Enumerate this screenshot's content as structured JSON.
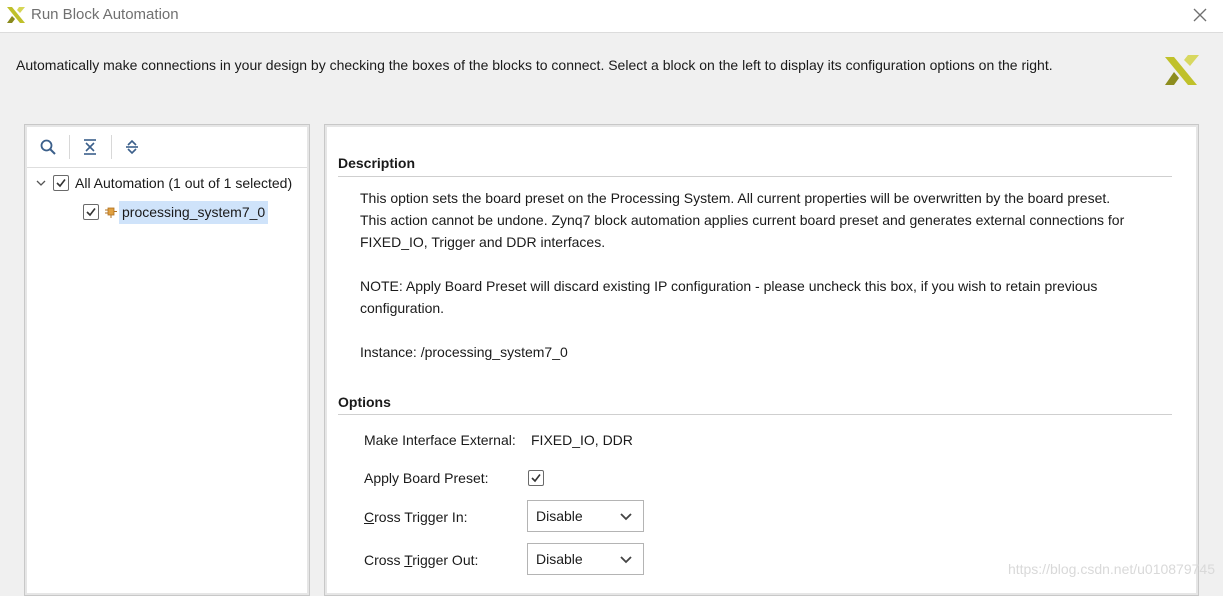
{
  "window": {
    "title": "Run Block Automation"
  },
  "header": {
    "description": "Automatically make connections in your design by checking the boxes of the blocks to connect. Select a block on the left to display its configuration options on the right."
  },
  "tree": {
    "root": {
      "label": "All Automation (1 out of 1 selected)",
      "checked": true,
      "expanded": true
    },
    "children": [
      {
        "label": "processing_system7_0",
        "checked": true,
        "selected": true
      }
    ]
  },
  "description": {
    "heading": "Description",
    "line1": "This option sets the board preset on the Processing System. All current properties will be overwritten by the board preset.",
    "line2": "This action cannot be undone. Zynq7 block automation applies current board preset and generates external connections for",
    "line3": "FIXED_IO, Trigger and DDR interfaces.",
    "note1": "NOTE: Apply Board Preset will discard existing IP configuration - please uncheck this box, if you wish to retain previous",
    "note2": "configuration.",
    "instance": "Instance: /processing_system7_0"
  },
  "options": {
    "heading": "Options",
    "make_interface_label": "Make Interface External:",
    "make_interface_value": "FIXED_IO, DDR",
    "apply_board_preset_label": "Apply Board Preset:",
    "apply_board_preset_checked": true,
    "cross_trigger_in": {
      "label_first": "C",
      "label_rest": "ross Trigger In:",
      "value": "Disable"
    },
    "cross_trigger_out": {
      "label_first": "Cross ",
      "label_under": "T",
      "label_rest": "rigger Out:",
      "value": "Disable"
    }
  },
  "watermark": "https://blog.csdn.net/u010879745",
  "colors": {
    "xilinx_yellow": "#c8c832",
    "selection_bg": "#cfe3fa"
  }
}
